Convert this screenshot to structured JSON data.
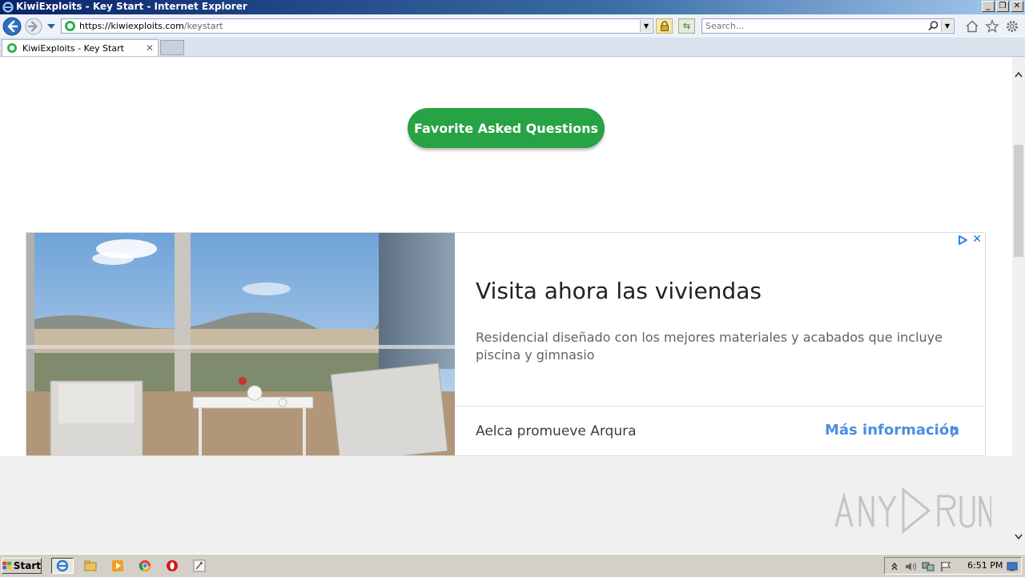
{
  "window": {
    "title": "KiwiExploits - Key Start - Internet Explorer",
    "controls": [
      "_",
      "❐",
      "✕"
    ]
  },
  "navbar": {
    "url_host": "https://kiwiexploits.com",
    "url_path": "/keystart",
    "search_placeholder": "Search..."
  },
  "tabs": [
    {
      "label": "KiwiExploits - Key Start",
      "close": "✕"
    }
  ],
  "page": {
    "faq_button": "Favorite Asked Questions"
  },
  "ad": {
    "headline": "Visita ahora las viviendas",
    "description": "Residencial diseñado con los mejores materiales y acabados que incluye piscina y gimnasio",
    "advertiser": "Aelca promueve Arqura",
    "cta": "Más información",
    "close": "✕"
  },
  "taskbar": {
    "start_label": "Start",
    "clock": "6:51 PM"
  },
  "watermark": "ANY RUN",
  "colors": {
    "faq_button": "#27a244",
    "cta": "#4a8fe0",
    "ad_choices": "#1a73e8"
  }
}
